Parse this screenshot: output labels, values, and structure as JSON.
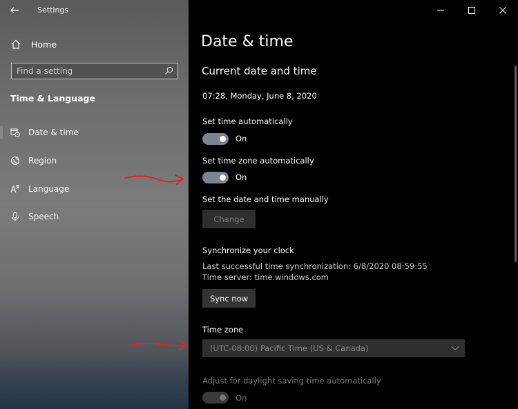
{
  "sidebar": {
    "app_title": "Settings",
    "home_label": "Home",
    "search_placeholder": "Find a setting",
    "section_title": "Time & Language",
    "items": [
      {
        "label": "Date & time",
        "icon": "calendar-clock-icon",
        "selected": true
      },
      {
        "label": "Region",
        "icon": "globe-icon",
        "selected": false
      },
      {
        "label": "Language",
        "icon": "language-icon",
        "selected": false
      },
      {
        "label": "Speech",
        "icon": "microphone-icon",
        "selected": false
      }
    ]
  },
  "main": {
    "page_title": "Date & time",
    "subtitle": "Current date and time",
    "current_datetime": "07:28, Monday, June 8, 2020",
    "set_time_auto": {
      "label": "Set time automatically",
      "state": "On"
    },
    "set_timezone_auto": {
      "label": "Set time zone automatically",
      "state": "On"
    },
    "manual": {
      "label": "Set the date and time manually",
      "button": "Change"
    },
    "sync": {
      "label": "Synchronize your clock",
      "last_sync": "Last successful time synchronization: 6/8/2020 08:59:55",
      "server": "Time server: time.windows.com",
      "button": "Sync now"
    },
    "timezone": {
      "label": "Time zone",
      "value": "(UTC-08:00) Pacific Time (US & Canada)"
    },
    "daylight": {
      "label": "Adjust for daylight saving time automatically",
      "state": "On"
    }
  },
  "colors": {
    "annotation_arrow": "#d9262b",
    "toggle_on": "#7b8590"
  }
}
